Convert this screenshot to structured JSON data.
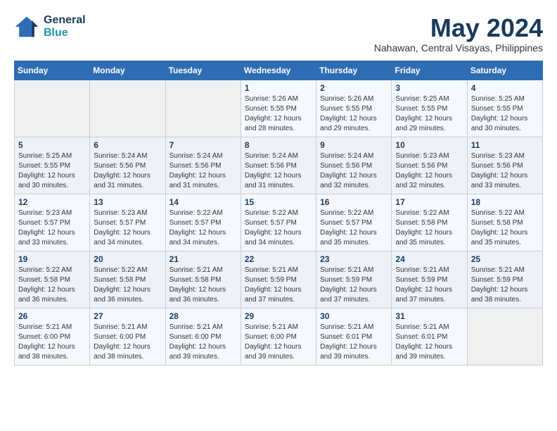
{
  "logo": {
    "line1": "General",
    "line2": "Blue"
  },
  "title": "May 2024",
  "subtitle": "Nahawan, Central Visayas, Philippines",
  "weekdays": [
    "Sunday",
    "Monday",
    "Tuesday",
    "Wednesday",
    "Thursday",
    "Friday",
    "Saturday"
  ],
  "weeks": [
    [
      {
        "day": "",
        "info": ""
      },
      {
        "day": "",
        "info": ""
      },
      {
        "day": "",
        "info": ""
      },
      {
        "day": "1",
        "info": "Sunrise: 5:26 AM\nSunset: 5:55 PM\nDaylight: 12 hours\nand 28 minutes."
      },
      {
        "day": "2",
        "info": "Sunrise: 5:26 AM\nSunset: 5:55 PM\nDaylight: 12 hours\nand 29 minutes."
      },
      {
        "day": "3",
        "info": "Sunrise: 5:25 AM\nSunset: 5:55 PM\nDaylight: 12 hours\nand 29 minutes."
      },
      {
        "day": "4",
        "info": "Sunrise: 5:25 AM\nSunset: 5:55 PM\nDaylight: 12 hours\nand 30 minutes."
      }
    ],
    [
      {
        "day": "5",
        "info": "Sunrise: 5:25 AM\nSunset: 5:55 PM\nDaylight: 12 hours\nand 30 minutes."
      },
      {
        "day": "6",
        "info": "Sunrise: 5:24 AM\nSunset: 5:56 PM\nDaylight: 12 hours\nand 31 minutes."
      },
      {
        "day": "7",
        "info": "Sunrise: 5:24 AM\nSunset: 5:56 PM\nDaylight: 12 hours\nand 31 minutes."
      },
      {
        "day": "8",
        "info": "Sunrise: 5:24 AM\nSunset: 5:56 PM\nDaylight: 12 hours\nand 31 minutes."
      },
      {
        "day": "9",
        "info": "Sunrise: 5:24 AM\nSunset: 5:56 PM\nDaylight: 12 hours\nand 32 minutes."
      },
      {
        "day": "10",
        "info": "Sunrise: 5:23 AM\nSunset: 5:56 PM\nDaylight: 12 hours\nand 32 minutes."
      },
      {
        "day": "11",
        "info": "Sunrise: 5:23 AM\nSunset: 5:56 PM\nDaylight: 12 hours\nand 33 minutes."
      }
    ],
    [
      {
        "day": "12",
        "info": "Sunrise: 5:23 AM\nSunset: 5:57 PM\nDaylight: 12 hours\nand 33 minutes."
      },
      {
        "day": "13",
        "info": "Sunrise: 5:23 AM\nSunset: 5:57 PM\nDaylight: 12 hours\nand 34 minutes."
      },
      {
        "day": "14",
        "info": "Sunrise: 5:22 AM\nSunset: 5:57 PM\nDaylight: 12 hours\nand 34 minutes."
      },
      {
        "day": "15",
        "info": "Sunrise: 5:22 AM\nSunset: 5:57 PM\nDaylight: 12 hours\nand 34 minutes."
      },
      {
        "day": "16",
        "info": "Sunrise: 5:22 AM\nSunset: 5:57 PM\nDaylight: 12 hours\nand 35 minutes."
      },
      {
        "day": "17",
        "info": "Sunrise: 5:22 AM\nSunset: 5:58 PM\nDaylight: 12 hours\nand 35 minutes."
      },
      {
        "day": "18",
        "info": "Sunrise: 5:22 AM\nSunset: 5:58 PM\nDaylight: 12 hours\nand 35 minutes."
      }
    ],
    [
      {
        "day": "19",
        "info": "Sunrise: 5:22 AM\nSunset: 5:58 PM\nDaylight: 12 hours\nand 36 minutes."
      },
      {
        "day": "20",
        "info": "Sunrise: 5:22 AM\nSunset: 5:58 PM\nDaylight: 12 hours\nand 36 minutes."
      },
      {
        "day": "21",
        "info": "Sunrise: 5:21 AM\nSunset: 5:58 PM\nDaylight: 12 hours\nand 36 minutes."
      },
      {
        "day": "22",
        "info": "Sunrise: 5:21 AM\nSunset: 5:59 PM\nDaylight: 12 hours\nand 37 minutes."
      },
      {
        "day": "23",
        "info": "Sunrise: 5:21 AM\nSunset: 5:59 PM\nDaylight: 12 hours\nand 37 minutes."
      },
      {
        "day": "24",
        "info": "Sunrise: 5:21 AM\nSunset: 5:59 PM\nDaylight: 12 hours\nand 37 minutes."
      },
      {
        "day": "25",
        "info": "Sunrise: 5:21 AM\nSunset: 5:59 PM\nDaylight: 12 hours\nand 38 minutes."
      }
    ],
    [
      {
        "day": "26",
        "info": "Sunrise: 5:21 AM\nSunset: 6:00 PM\nDaylight: 12 hours\nand 38 minutes."
      },
      {
        "day": "27",
        "info": "Sunrise: 5:21 AM\nSunset: 6:00 PM\nDaylight: 12 hours\nand 38 minutes."
      },
      {
        "day": "28",
        "info": "Sunrise: 5:21 AM\nSunset: 6:00 PM\nDaylight: 12 hours\nand 39 minutes."
      },
      {
        "day": "29",
        "info": "Sunrise: 5:21 AM\nSunset: 6:00 PM\nDaylight: 12 hours\nand 39 minutes."
      },
      {
        "day": "30",
        "info": "Sunrise: 5:21 AM\nSunset: 6:01 PM\nDaylight: 12 hours\nand 39 minutes."
      },
      {
        "day": "31",
        "info": "Sunrise: 5:21 AM\nSunset: 6:01 PM\nDaylight: 12 hours\nand 39 minutes."
      },
      {
        "day": "",
        "info": ""
      }
    ]
  ]
}
